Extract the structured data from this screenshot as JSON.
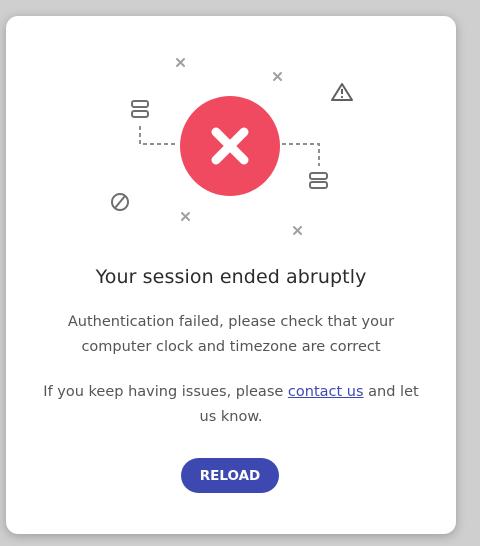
{
  "dialog": {
    "title": "Your session ended abruptly",
    "message": "Authentication failed, please check that your computer clock and timezone are correct",
    "help_prefix": "If you keep having issues, please ",
    "help_link": "contact us",
    "help_suffix": " and let us know.",
    "reload_label": "RELOAD"
  },
  "illustration": {
    "icons": [
      "error-x-icon",
      "server-icon",
      "warning-icon",
      "blocked-icon",
      "x-mark-icon"
    ]
  },
  "colors": {
    "error": "#ef4a5f",
    "accent": "#3d49b0",
    "icon_gray": "#8a8a8a"
  }
}
